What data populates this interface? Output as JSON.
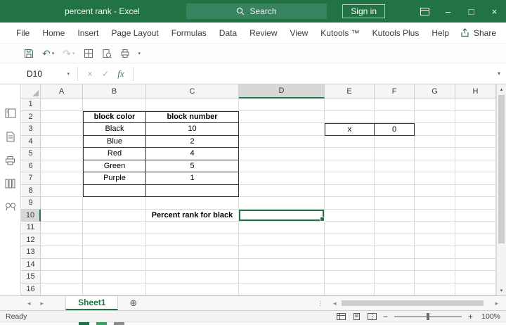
{
  "title_bar": {
    "title": "percent rank - Excel",
    "search_label": "Search",
    "sign_in_label": "Sign in"
  },
  "menu": {
    "tabs": [
      "File",
      "Home",
      "Insert",
      "Page Layout",
      "Formulas",
      "Data",
      "Review",
      "View",
      "Kutools ™",
      "Kutools Plus",
      "Help"
    ],
    "share_label": "Share"
  },
  "formula_bar": {
    "name_box": "D10",
    "fx_label": "fx",
    "formula": ""
  },
  "grid": {
    "columns": [
      "A",
      "B",
      "C",
      "D",
      "E",
      "F",
      "G",
      "H"
    ],
    "rows": [
      "1",
      "2",
      "3",
      "4",
      "5",
      "6",
      "7",
      "8",
      "9",
      "10",
      "11",
      "12",
      "13",
      "14",
      "15",
      "16"
    ],
    "selected_cell": "D10",
    "selected_column": "D",
    "selected_row": "10",
    "bold_cells": [
      "B2",
      "C2",
      "C10"
    ]
  },
  "cells": {
    "B2": "block color",
    "C2": "block number",
    "B3": "Black",
    "C3": "10",
    "B4": "Blue",
    "C4": "2",
    "B5": "Red",
    "C5": "4",
    "B6": "Green",
    "C6": "5",
    "B7": "Purple",
    "C7": "1",
    "E3": "x",
    "F3": "0",
    "C10": "Percent rank for black"
  },
  "sheet_bar": {
    "tabs": [
      "Sheet1"
    ]
  },
  "status_bar": {
    "mode": "Ready",
    "zoom": "100%"
  },
  "colors": {
    "accent_green": "#217346"
  }
}
